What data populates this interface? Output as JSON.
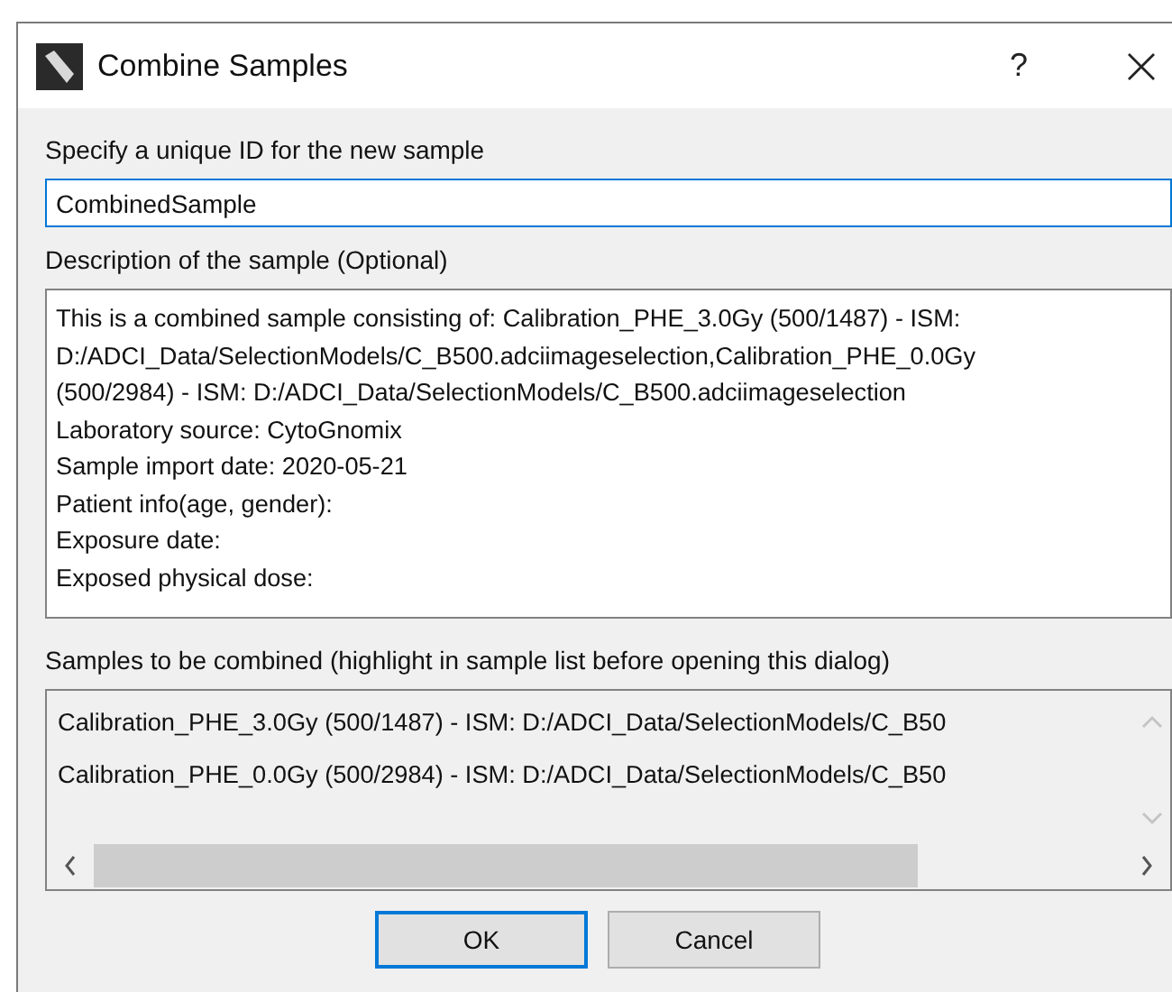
{
  "window": {
    "title": "Combine Samples",
    "help_button": "?"
  },
  "id_field": {
    "label": "Specify a unique ID for the new sample",
    "value": "CombinedSample",
    "focused": true
  },
  "description": {
    "label": "Description of the sample (Optional)",
    "lines": [
      "This is a combined sample consisting of: Calibration_PHE_3.0Gy (500/1487) - ISM:",
      "D:/ADCI_Data/SelectionModels/C_B500.adciimageselection,Calibration_PHE_0.0Gy",
      "(500/2984) - ISM: D:/ADCI_Data/SelectionModels/C_B500.adciimageselection",
      "Laboratory source: CytoGnomix",
      "Sample import date: 2020-05-21",
      "Patient info(age, gender):",
      "Exposure date:",
      "Exposed physical dose:"
    ]
  },
  "samples": {
    "label": "Samples to be combined (highlight in sample list before opening this dialog)",
    "items": [
      "Calibration_PHE_3.0Gy (500/1487) - ISM: D:/ADCI_Data/SelectionModels/C_B50",
      "Calibration_PHE_0.0Gy (500/2984) - ISM: D:/ADCI_Data/SelectionModels/C_B50"
    ]
  },
  "buttons": [
    {
      "label": "OK",
      "default": true
    },
    {
      "label": "Cancel",
      "default": false
    }
  ]
}
